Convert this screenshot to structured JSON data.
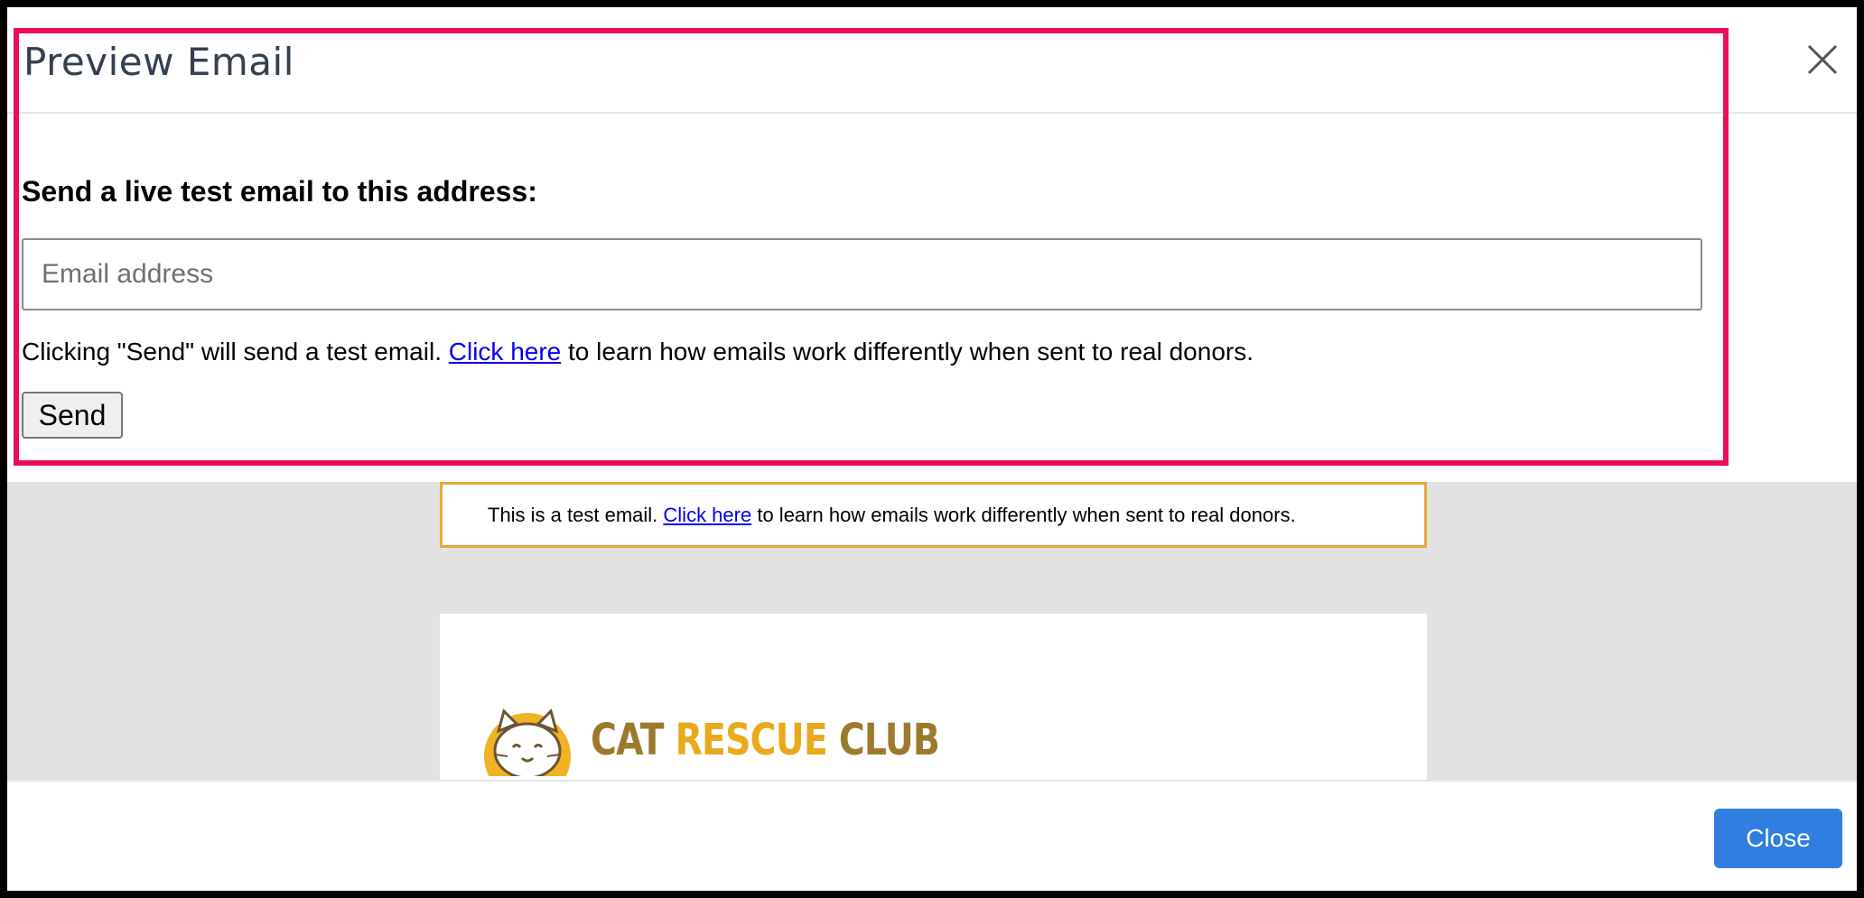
{
  "modal": {
    "title": "Preview Email",
    "close_icon": "close-icon"
  },
  "send_test": {
    "label": "Send a live test email to this address:",
    "email_placeholder": "Email address",
    "email_value": "",
    "help_prefix": "Clicking \"Send\" will send a test email.",
    "help_link": "Click here",
    "help_suffix": "to learn how emails work differently when sent to real donors.",
    "send_button": "Send"
  },
  "preview": {
    "banner_prefix": "This is a test email.",
    "banner_link": "Click here",
    "banner_suffix": "to learn how emails work differently when sent to real donors.",
    "logo_word1": "CAT",
    "logo_word2": "RESCUE",
    "logo_word3": "CLUB",
    "logo_icon": "cat-face-icon"
  },
  "footer": {
    "close_button": "Close"
  },
  "colors": {
    "highlight": "#ec0d58",
    "banner_border": "#e5a93a",
    "primary_button": "#2f7ee0",
    "logo_gold": "#e8aa1c",
    "logo_brown": "#9b7a2c"
  }
}
